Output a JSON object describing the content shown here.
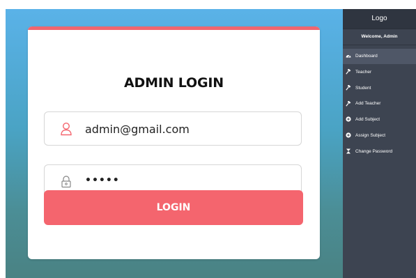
{
  "login": {
    "title": "ADMIN LOGIN",
    "email_value": "admin@gmail.com",
    "password_value": "•••••",
    "button_label": "LOGIN"
  },
  "sidebar": {
    "logo": "Logo",
    "welcome": "Welcome, Admin",
    "items": [
      {
        "label": "Dashboard",
        "icon": "dashboard-icon",
        "active": true
      },
      {
        "label": "Teacher",
        "icon": "gavel-icon"
      },
      {
        "label": "Student",
        "icon": "gavel-icon"
      },
      {
        "label": "Add Teacher",
        "icon": "gavel-icon"
      },
      {
        "label": "Add Subject",
        "icon": "circle-plus-icon"
      },
      {
        "label": "Assign Subject",
        "icon": "circle-plus-icon"
      },
      {
        "label": "Change Password",
        "icon": "hourglass-icon"
      }
    ]
  },
  "colors": {
    "accent": "#f4656e",
    "sidebar_bg": "#3d4451",
    "sidebar_active": "#4f5767"
  }
}
